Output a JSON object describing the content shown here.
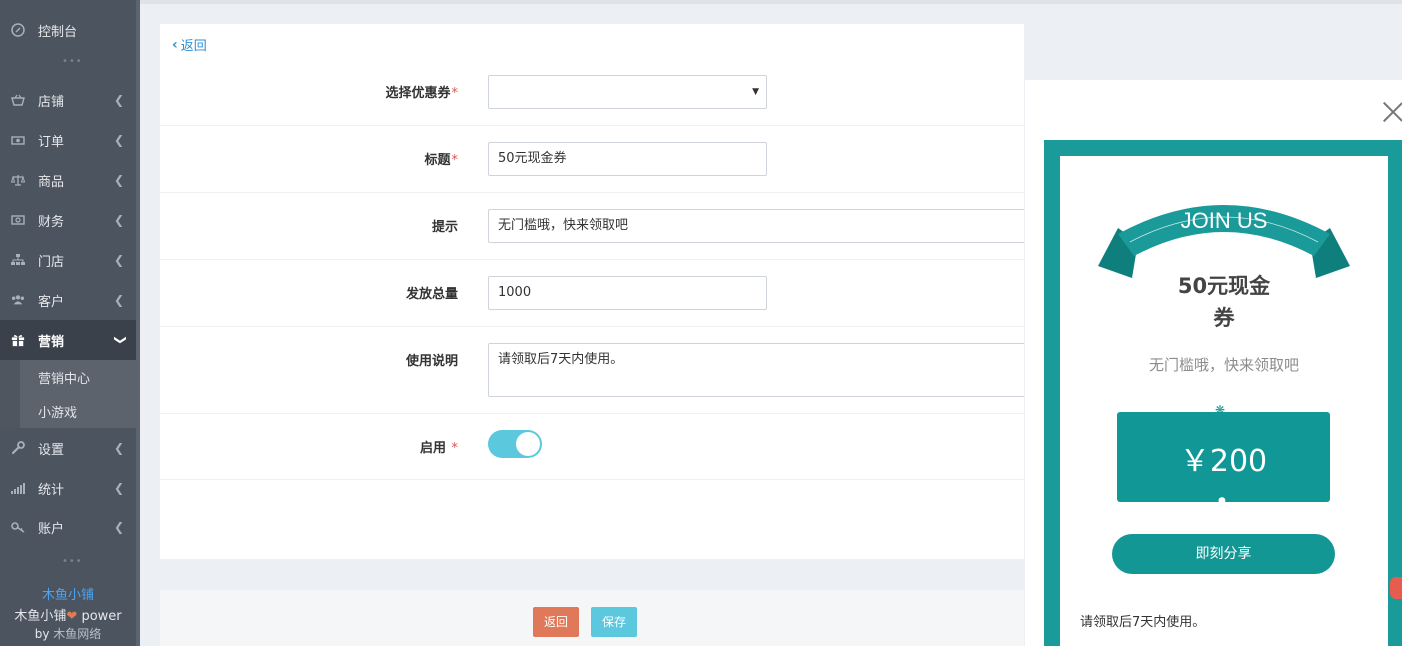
{
  "sidebar": {
    "dashboard": "控制台",
    "items": [
      {
        "label": "店铺",
        "icon": "basket-icon"
      },
      {
        "label": "订单",
        "icon": "money-icon"
      },
      {
        "label": "商品",
        "icon": "scale-icon"
      },
      {
        "label": "财务",
        "icon": "cash-icon"
      },
      {
        "label": "门店",
        "icon": "sitemap-icon"
      },
      {
        "label": "客户",
        "icon": "users-icon"
      }
    ],
    "active": {
      "label": "营销",
      "icon": "gift-icon"
    },
    "subitems": [
      "营销中心",
      "小游戏"
    ],
    "after": [
      {
        "label": "设置",
        "icon": "wrench-icon"
      },
      {
        "label": "统计",
        "icon": "signal-icon"
      },
      {
        "label": "账户",
        "icon": "key-icon"
      }
    ],
    "brand_name": "木鱼小铺",
    "powered": "木鱼小铺",
    "powered_suffix": "power",
    "by": "by",
    "company": "木鱼网络"
  },
  "form": {
    "back_label": "返回",
    "fields": {
      "coupon": {
        "label": "选择优惠券",
        "value": ""
      },
      "title": {
        "label": "标题",
        "value": "50元现金券"
      },
      "tip": {
        "label": "提示",
        "value": "无门槛哦，快来领取吧"
      },
      "total": {
        "label": "发放总量",
        "value": "1000"
      },
      "desc": {
        "label": "使用说明",
        "value": "请领取后7天内使用。"
      },
      "enable": {
        "label": "启用",
        "value": true
      }
    },
    "required_mark": "*",
    "buttons": {
      "back": "返回",
      "save": "保存"
    }
  },
  "preview": {
    "banner": "JOIN US",
    "title": "50元现金券",
    "tip": "无门槛哦，快来领取吧",
    "amount": "￥200",
    "share": "即刻分享",
    "desc": "请领取后7天内使用。"
  },
  "colors": {
    "sidebar_bg": "#4c5460",
    "teal": "#139794",
    "toggle_on": "#5bc8de",
    "back_btn": "#e0795a",
    "save_btn": "#5bc8de",
    "link": "#2b8fd6",
    "brand_blue": "#4da3f0"
  }
}
